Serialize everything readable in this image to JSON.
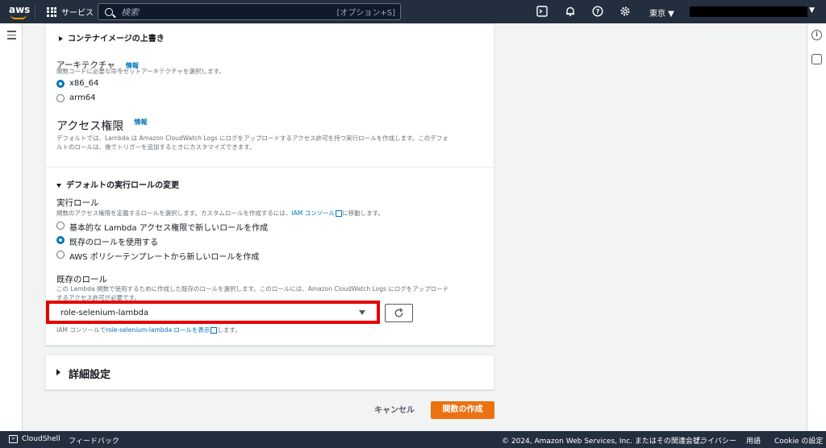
{
  "topbar": {
    "logo": "aws",
    "services": "サービス",
    "search_placeholder": "検索",
    "search_shortcut": "[オプション+S]",
    "region": "東京 ▼",
    "account_caret": "▼"
  },
  "form": {
    "container_override": "コンテナイメージの上書き",
    "architecture": {
      "label": "アーキテクチャ",
      "info": "情報",
      "desc": "関数コードに必要な命令セットアーキテクチャを選択します。",
      "options": [
        "x86_64",
        "arm64"
      ],
      "selected": "x86_64"
    },
    "permissions": {
      "title": "アクセス権限",
      "info": "情報",
      "desc_line1": "デフォルトでは、Lambda は Amazon CloudWatch Logs にログをアップロードするアクセス許可を持つ実行ロールを作成します。このデフォ",
      "desc_line2": "ルトのロールは、後でトリガーを追加するときにカスタマイズできます。"
    },
    "default_role_change": "デフォルトの実行ロールの変更",
    "exec_role": {
      "label": "実行ロール",
      "desc_prefix": "関数のアクセス権限を定義するロールを選択します。カスタムロールを作成するには、",
      "desc_link": "IAM コンソール",
      "desc_suffix": "に移動します。",
      "options": [
        "基本的な Lambda アクセス権限で新しいロールを作成",
        "既存のロールを使用する",
        "AWS ポリシーテンプレートから新しいロールを作成"
      ],
      "selected": "既存のロールを使用する"
    },
    "existing_role": {
      "label": "既存のロール",
      "desc_line1": "この Lambda 関数で使用するために作成した既存のロールを選択します。このロールには、Amazon CloudWatch Logs にログをアップロード",
      "desc_line2": "するアクセス許可が必要です。",
      "value": "role-selenium-lambda",
      "hint_prefix": "IAM コンソールで",
      "hint_link": "role-selenium-lambda ロールを表示",
      "hint_suffix": "します。"
    },
    "advanced": "詳細設定",
    "cancel": "キャンセル",
    "create": "関数の作成"
  },
  "footer": {
    "cloudshell": "CloudShell",
    "feedback": "フィードバック",
    "copyright": "© 2024, Amazon Web Services, Inc. またはその関連会社。",
    "privacy": "プライバシー",
    "terms": "用語",
    "cookie": "Cookie の設定"
  }
}
